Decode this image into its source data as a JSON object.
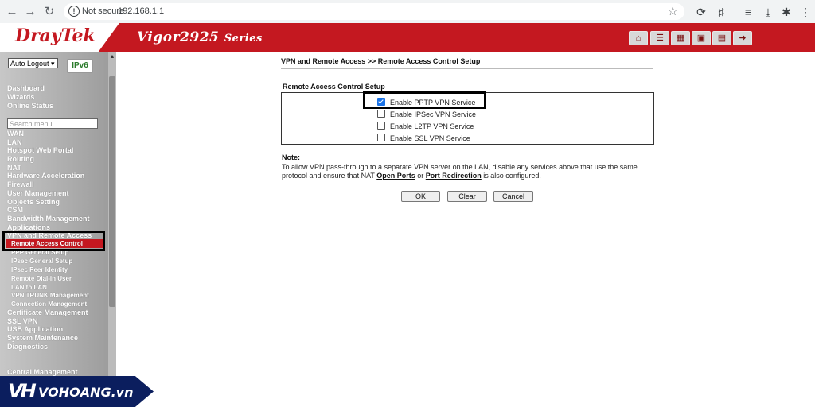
{
  "browser": {
    "security_label": "Not secure",
    "url": "192.168.1.1"
  },
  "header": {
    "brand": "DrayTek",
    "model": "Vigor2925",
    "series": "Series",
    "icons": [
      "home-icon",
      "menu-icon",
      "settings-icon",
      "save-icon",
      "book-icon",
      "logout-icon"
    ]
  },
  "sidebar": {
    "logout_select": "Auto Logout",
    "ipv6_badge": "IPv6",
    "top_items": [
      "Dashboard",
      "Wizards",
      "Online Status"
    ],
    "search_placeholder": "Search menu",
    "items": [
      "WAN",
      "LAN",
      "Hotspot Web Portal",
      "Routing",
      "NAT",
      "Hardware Acceleration",
      "Firewall",
      "User Management",
      "Objects Setting",
      "CSM",
      "Bandwidth Management",
      "Applications",
      "VPN and Remote Access"
    ],
    "sub_items": [
      "Remote Access Control",
      "PPP General Setup",
      "IPsec General Setup",
      "IPsec Peer Identity",
      "Remote Dial-in User",
      "LAN to LAN",
      "VPN TRUNK Management",
      "Connection Management"
    ],
    "bottom_items": [
      "Certificate Management",
      "SSL VPN",
      "USB Application",
      "System Maintenance",
      "Diagnostics"
    ],
    "footer_item": "Central Management"
  },
  "main": {
    "page_title": "VPN and Remote Access >> Remote Access Control Setup",
    "section_title": "Remote Access Control Setup",
    "options": [
      {
        "label": "Enable PPTP VPN Service",
        "checked": true
      },
      {
        "label": "Enable IPSec VPN Service",
        "checked": false
      },
      {
        "label": "Enable L2TP VPN Service",
        "checked": false
      },
      {
        "label": "Enable SSL VPN Service",
        "checked": false
      }
    ],
    "note_title": "Note:",
    "note_part1": "To allow VPN pass-through to a separate VPN server on the LAN, disable any services above that use the same protocol and ensure that NAT ",
    "note_link1": "Open Ports",
    "note_mid": " or ",
    "note_link2": "Port Redirection",
    "note_part2": " is also configured.",
    "buttons": {
      "ok": "OK",
      "clear": "Clear",
      "cancel": "Cancel"
    }
  },
  "watermark": {
    "mark": "VH",
    "text": "VOHOANG.vn"
  },
  "colors": {
    "brand_red": "#c41820",
    "highlight": "#000000",
    "checkbox_blue": "#1a73e8"
  }
}
